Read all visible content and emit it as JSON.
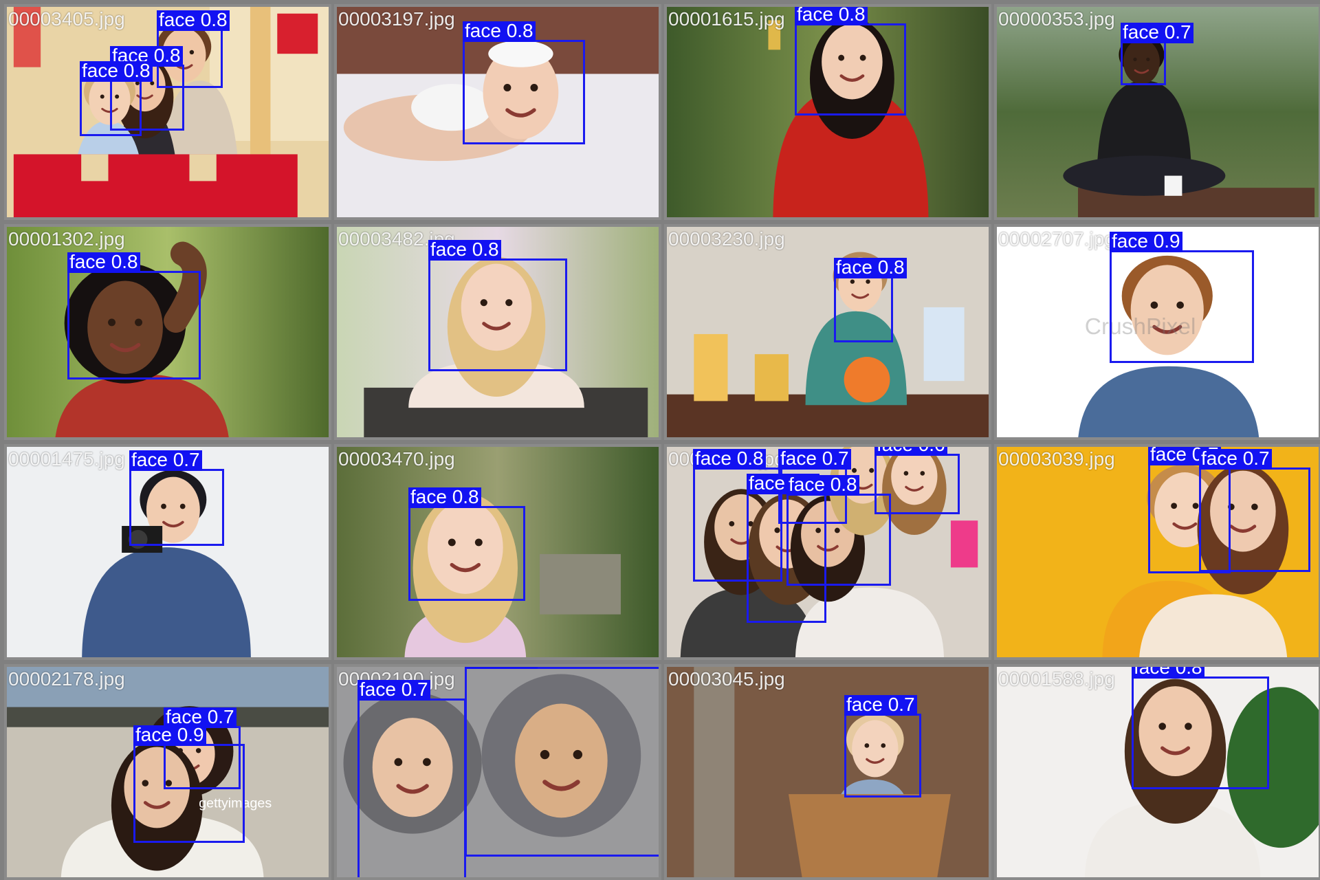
{
  "mosaic": {
    "tiles": [
      {
        "filename": "00003405.jpg",
        "scene": "kids-playground",
        "detections": [
          {
            "label": "face 0.8",
            "class": "face",
            "score": 0.8
          },
          {
            "label": "face 0.8",
            "class": "face",
            "score": 0.8
          },
          {
            "label": "face 0.8",
            "class": "face",
            "score": 0.8
          }
        ]
      },
      {
        "filename": "00003197.jpg",
        "scene": "baby-on-blanket",
        "detections": [
          {
            "label": "face 0.8",
            "class": "face",
            "score": 0.8
          }
        ]
      },
      {
        "filename": "00001615.jpg",
        "scene": "woman-red-dress",
        "detections": [
          {
            "label": "face 0.8",
            "class": "face",
            "score": 0.8
          }
        ]
      },
      {
        "filename": "00000353.jpg",
        "scene": "man-meditating-garden",
        "detections": [
          {
            "label": "face 0.7",
            "class": "face",
            "score": 0.7
          }
        ]
      },
      {
        "filename": "00001302.jpg",
        "scene": "woman-curly-hair",
        "detections": [
          {
            "label": "face 0.8",
            "class": "face",
            "score": 0.8
          }
        ]
      },
      {
        "filename": "00003482.jpg",
        "scene": "girl-on-bench",
        "detections": [
          {
            "label": "face 0.8",
            "class": "face",
            "score": 0.8
          }
        ]
      },
      {
        "filename": "00003230.jpg",
        "scene": "toddler-kitchen",
        "detections": [
          {
            "label": "face 0.8",
            "class": "face",
            "score": 0.8
          }
        ]
      },
      {
        "filename": "00002707.jpg",
        "scene": "boy-white-background",
        "detections": [
          {
            "label": "face 0.9",
            "class": "face",
            "score": 0.9
          }
        ]
      },
      {
        "filename": "00001475.jpg",
        "scene": "person-with-camera",
        "detections": [
          {
            "label": "face 0.7",
            "class": "face",
            "score": 0.7
          }
        ]
      },
      {
        "filename": "00003470.jpg",
        "scene": "blonde-girl-park",
        "detections": [
          {
            "label": "face 0.8",
            "class": "face",
            "score": 0.8
          }
        ]
      },
      {
        "filename": "00000000.jpg",
        "scene": "women-group-selfie",
        "detections": [
          {
            "label": "face 0.8",
            "class": "face",
            "score": 0.8
          },
          {
            "label": "face 0.7",
            "class": "face",
            "score": 0.7
          },
          {
            "label": "face 0.6",
            "class": "face",
            "score": 0.6
          },
          {
            "label": "face 0.8",
            "class": "face",
            "score": 0.8
          },
          {
            "label": "face 0.8",
            "class": "face",
            "score": 0.8
          }
        ]
      },
      {
        "filename": "00003039.jpg",
        "scene": "mother-son-yellow",
        "detections": [
          {
            "label": "face 0.7",
            "class": "face",
            "score": 0.7
          },
          {
            "label": "face 0.7",
            "class": "face",
            "score": 0.7
          }
        ]
      },
      {
        "filename": "00002178.jpg",
        "scene": "mother-child-snow",
        "detections": [
          {
            "label": "face 0.7",
            "class": "face",
            "score": 0.7
          },
          {
            "label": "face 0.9",
            "class": "face",
            "score": 0.9
          }
        ]
      },
      {
        "filename": "00002190.jpg",
        "scene": "two-fur-hats",
        "detections": [
          {
            "label": "face 0.7",
            "class": "face",
            "score": 0.7
          },
          {
            "label": "face 0.7",
            "class": "face",
            "score": 0.7
          }
        ]
      },
      {
        "filename": "00003045.jpg",
        "scene": "baby-in-basket",
        "detections": [
          {
            "label": "face 0.7",
            "class": "face",
            "score": 0.7
          }
        ]
      },
      {
        "filename": "00001588.jpg",
        "scene": "woman-with-plant",
        "detections": [
          {
            "label": "face 0.8",
            "class": "face",
            "score": 0.8
          }
        ]
      }
    ],
    "watermarks": {
      "gettyimages": "gettyimages",
      "crushpixel": "CrushPixel"
    }
  }
}
